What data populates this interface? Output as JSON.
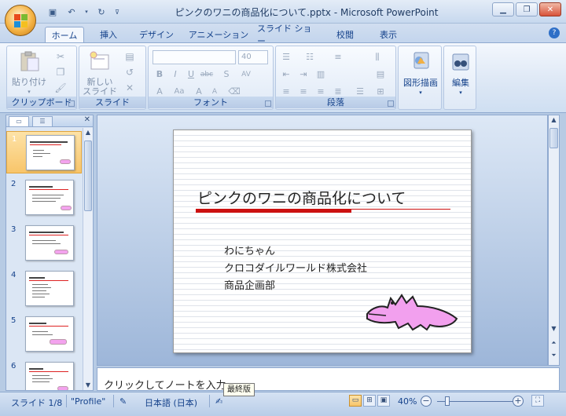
{
  "window": {
    "title": "ピンクのワニの商品化について.pptx - Microsoft PowerPoint",
    "controls": [
      "minimize",
      "restore",
      "close"
    ]
  },
  "ribbon_tabs": [
    {
      "label": "ホーム",
      "active": true
    },
    {
      "label": "挿入"
    },
    {
      "label": "デザイン"
    },
    {
      "label": "アニメーション"
    },
    {
      "label": "スライド ショー"
    },
    {
      "label": "校閲"
    },
    {
      "label": "表示"
    }
  ],
  "ribbon": {
    "clipboard": {
      "label": "クリップボード",
      "paste": "貼り付け"
    },
    "slides": {
      "label": "スライド",
      "new_slide_line1": "新しい",
      "new_slide_line2": "スライド"
    },
    "font": {
      "label": "フォント",
      "size": "40"
    },
    "paragraph": {
      "label": "段落"
    },
    "drawing": {
      "label": "図形描画"
    },
    "editing": {
      "label": "編集"
    }
  },
  "thumbnails": [
    {
      "num": "1",
      "selected": true
    },
    {
      "num": "2"
    },
    {
      "num": "3"
    },
    {
      "num": "4"
    },
    {
      "num": "5"
    },
    {
      "num": "6"
    }
  ],
  "slide": {
    "title": "ピンクのワニの商品化について",
    "subtitle_lines": [
      "わにちゃん",
      "クロコダイルワールド株式会社",
      "商品企画部"
    ]
  },
  "notes": {
    "placeholder": "クリックしてノートを入力"
  },
  "status": {
    "slide_info": "スライド 1/8",
    "theme": "\"Profile\"",
    "language": "日本語 (日本)",
    "tooltip": "最終版",
    "zoom": "40%"
  }
}
